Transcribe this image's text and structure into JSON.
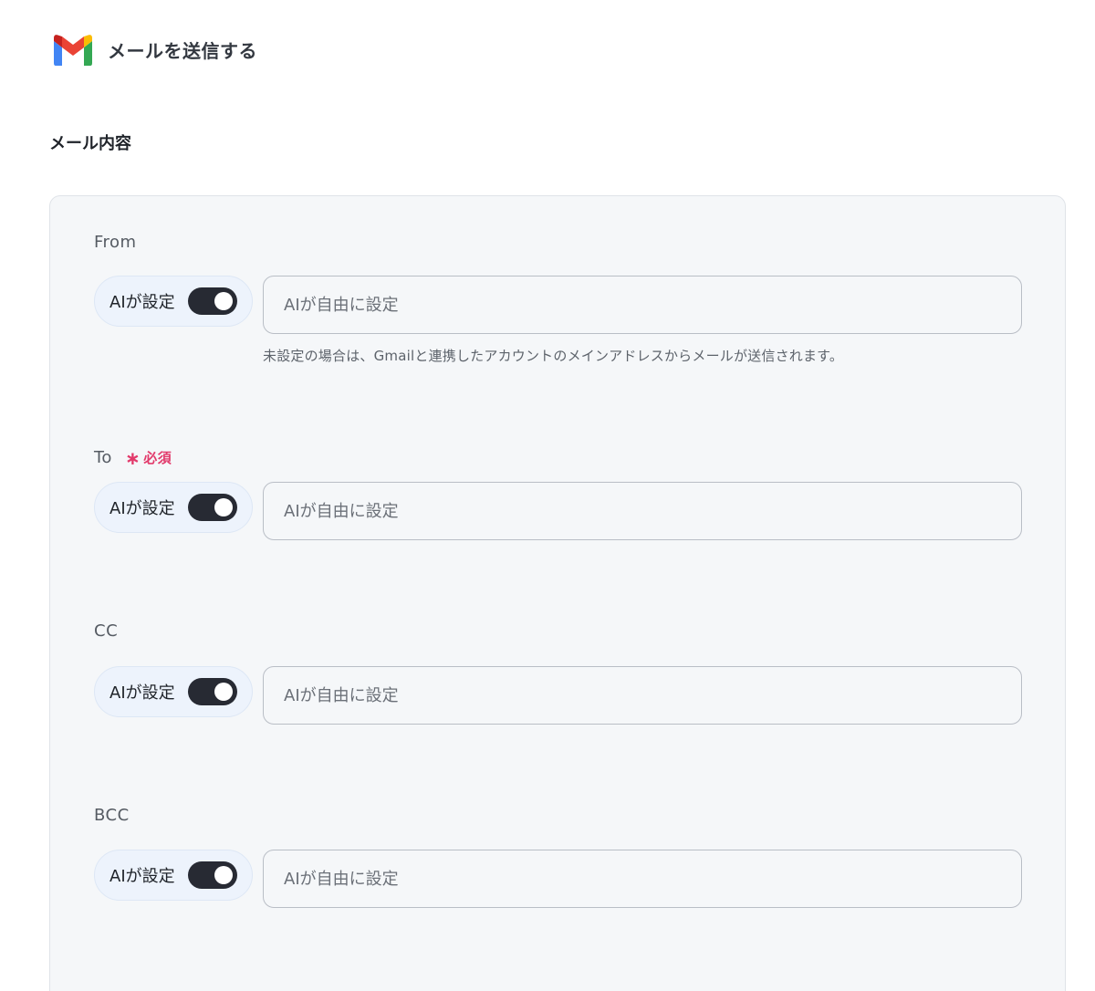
{
  "header": {
    "title": "メールを送信する",
    "icon": "gmail-icon"
  },
  "section": {
    "title": "メール内容"
  },
  "fields": [
    {
      "label": "From",
      "required": false,
      "ai_label": "AIが設定",
      "ai_enabled": true,
      "value": "",
      "placeholder": "AIが自由に設定",
      "hint": "未設定の場合は、Gmailと連携したアカウントのメインアドレスからメールが送信されます。"
    },
    {
      "label": "To",
      "required": true,
      "required_label": "必須",
      "ai_label": "AIが設定",
      "ai_enabled": true,
      "value": "",
      "placeholder": "AIが自由に設定"
    },
    {
      "label": "CC",
      "required": false,
      "ai_label": "AIが設定",
      "ai_enabled": true,
      "value": "",
      "placeholder": "AIが自由に設定"
    },
    {
      "label": "BCC",
      "required": false,
      "ai_label": "AIが設定",
      "ai_enabled": true,
      "value": "",
      "placeholder": "AIが自由に設定"
    }
  ],
  "colors": {
    "panel_bg": "#f5f7f9",
    "required": "#e23a6b",
    "toggle_on": "#272a33",
    "chip_bg": "#edf3fc"
  }
}
